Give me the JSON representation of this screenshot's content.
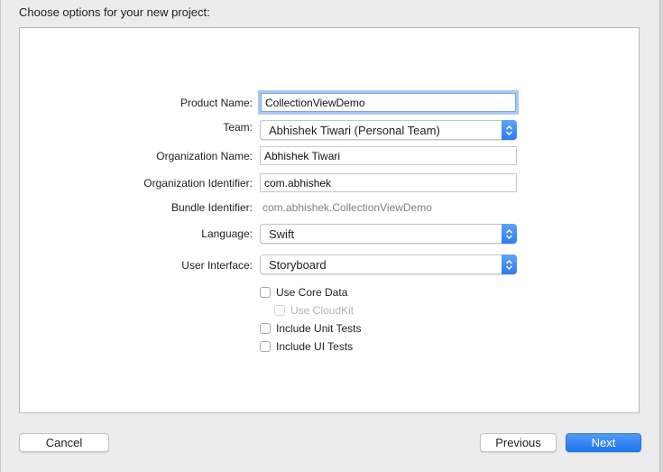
{
  "dialog": {
    "heading": "Choose options for your new project:"
  },
  "form": {
    "product_name": {
      "label": "Product Name:",
      "value": "CollectionViewDemo"
    },
    "team": {
      "label": "Team:",
      "value": "Abhishek Tiwari (Personal Team)"
    },
    "organization_name": {
      "label": "Organization Name:",
      "value": "Abhishek Tiwari"
    },
    "organization_identifier": {
      "label": "Organization Identifier:",
      "value": "com.abhishek"
    },
    "bundle_identifier": {
      "label": "Bundle Identifier:",
      "value": "com.abhishek.CollectionViewDemo"
    },
    "language": {
      "label": "Language:",
      "value": "Swift"
    },
    "user_interface": {
      "label": "User Interface:",
      "value": "Storyboard"
    }
  },
  "checkboxes": [
    {
      "label": "Use Core Data",
      "checked": false,
      "enabled": true
    },
    {
      "label": "Use CloudKit",
      "checked": false,
      "enabled": false
    },
    {
      "label": "Include Unit Tests",
      "checked": false,
      "enabled": true
    },
    {
      "label": "Include UI Tests",
      "checked": false,
      "enabled": true
    }
  ],
  "buttons": {
    "cancel": "Cancel",
    "previous": "Previous",
    "next": "Next"
  },
  "colors": {
    "accent": "#2c7ef0",
    "focus_ring": "#a9c8f2"
  },
  "icons": {
    "popup_stepper": "chevron-up-down-icon"
  }
}
